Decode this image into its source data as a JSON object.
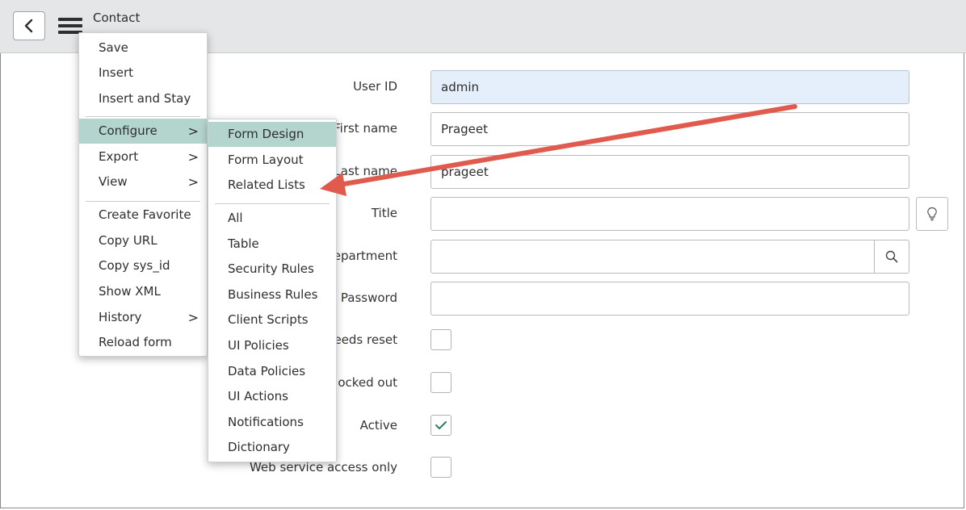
{
  "header": {
    "title": "Contact"
  },
  "form": {
    "labels": {
      "user_id": "User ID",
      "first_name": "First name",
      "last_name": "Last name",
      "title": "Title",
      "department": "epartment",
      "password": "Password",
      "needs_reset": "eeds reset",
      "locked_out": "ocked out",
      "active": "Active",
      "web_service": "Web service access only"
    },
    "values": {
      "user_id": "admin",
      "first_name": "Prageet",
      "last_name": "prageet",
      "title": "",
      "department": "",
      "password": ""
    },
    "checkboxes": {
      "needs_reset": false,
      "locked_out": false,
      "active": true,
      "web_service": false
    }
  },
  "context_menu": {
    "items": {
      "save": "Save",
      "insert": "Insert",
      "insert_stay": "Insert and Stay",
      "configure": "Configure",
      "export": "Export",
      "view": "View",
      "create_favorite": "Create Favorite",
      "copy_url": "Copy URL",
      "copy_sys_id": "Copy sys_id",
      "show_xml": "Show XML",
      "history": "History",
      "reload_form": "Reload form"
    },
    "chevron": ">"
  },
  "configure_submenu": {
    "items": {
      "form_design": "Form Design",
      "form_layout": "Form Layout",
      "related_lists": "Related Lists",
      "all": "All",
      "table": "Table",
      "security_rules": "Security Rules",
      "business_rules": "Business Rules",
      "client_scripts": "Client Scripts",
      "ui_policies": "UI Policies",
      "data_policies": "Data Policies",
      "ui_actions": "UI Actions",
      "notifications": "Notifications",
      "dictionary": "Dictionary"
    }
  },
  "colors": {
    "menu_highlight": "#b4d5cd",
    "annotation_arrow": "#e05a4e",
    "readonly_field": "#e5eefb",
    "checkmark": "#2f7d5b"
  },
  "icons": {
    "back": "chevron-left-icon",
    "menu": "hamburger-icon",
    "lookup": "search-icon",
    "suggestion": "lightbulb-icon",
    "check": "checkmark-icon"
  }
}
